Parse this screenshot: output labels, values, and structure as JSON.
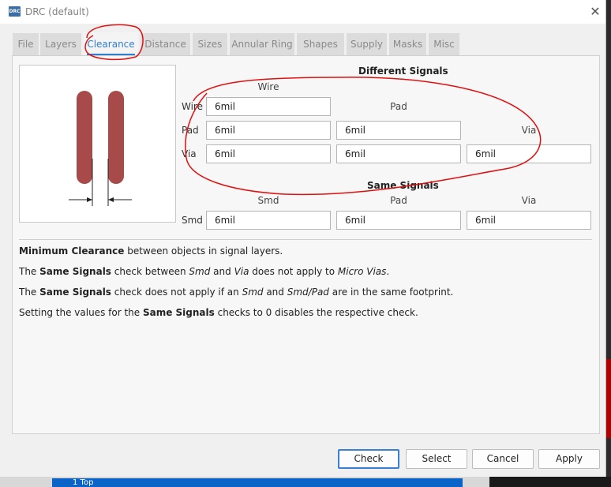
{
  "window": {
    "title": "DRC (default)",
    "icon_text": "DRC"
  },
  "tabs": [
    {
      "label": "File"
    },
    {
      "label": "Layers"
    },
    {
      "label": "Clearance"
    },
    {
      "label": "Distance"
    },
    {
      "label": "Sizes"
    },
    {
      "label": "Annular Ring"
    },
    {
      "label": "Shapes"
    },
    {
      "label": "Supply"
    },
    {
      "label": "Masks"
    },
    {
      "label": "Misc"
    }
  ],
  "active_tab": "Clearance",
  "different_signals": {
    "title": "Different Signals",
    "col_wire": "Wire",
    "col_pad": "Pad",
    "col_via": "Via",
    "row_wire": "Wire",
    "row_pad": "Pad",
    "row_via": "Via",
    "wire_wire": "6mil",
    "pad_wire": "6mil",
    "pad_pad": "6mil",
    "via_wire": "6mil",
    "via_pad": "6mil",
    "via_via": "6mil"
  },
  "same_signals": {
    "title": "Same Signals",
    "col_smd": "Smd",
    "col_pad": "Pad",
    "col_via": "Via",
    "row_smd": "Smd",
    "smd_smd": "6mil",
    "smd_pad": "6mil",
    "smd_via": "6mil"
  },
  "description": {
    "l1_b": "Minimum Clearance",
    "l1_t": " between objects in signal layers.",
    "l2_a": "The ",
    "l2_b": "Same Signals",
    "l2_c": " check between ",
    "l2_i1": "Smd",
    "l2_d": " and ",
    "l2_i2": "Via",
    "l2_e": " does not apply to ",
    "l2_i3": "Micro Vias",
    "l2_f": ".",
    "l3_a": "The ",
    "l3_b": "Same Signals",
    "l3_c": " check does not apply if an ",
    "l3_i1": "Smd",
    "l3_d": " and ",
    "l3_i2": "Smd/Pad",
    "l3_e": " are in the same footprint.",
    "l4_a": "Setting the values for the ",
    "l4_b": "Same Signals",
    "l4_c": " checks to 0 disables the respective check."
  },
  "buttons": {
    "check": "Check",
    "select": "Select",
    "cancel": "Cancel",
    "apply": "Apply"
  },
  "background_app": {
    "layer_label": "1 Top"
  },
  "colors": {
    "accent": "#2f7fd0",
    "pad_fill": "#a84a4a",
    "annotation": "#e01010"
  }
}
